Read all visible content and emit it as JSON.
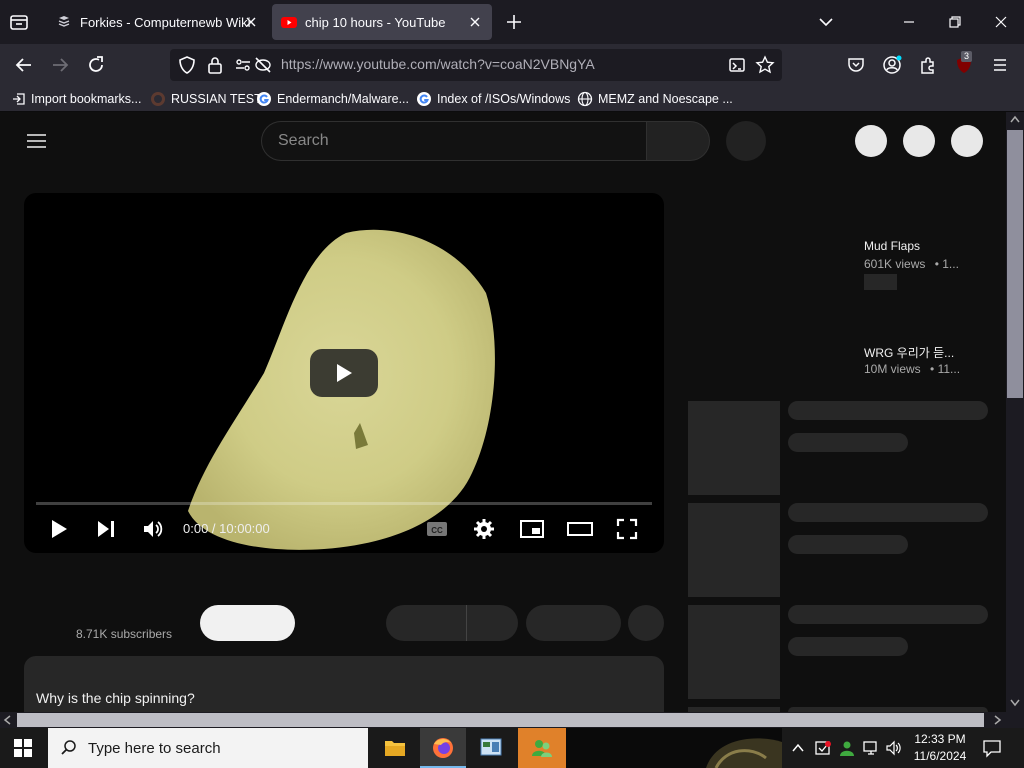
{
  "browser": {
    "tabs": [
      {
        "title": "Forkies - Computernewb Wiki",
        "active": false
      },
      {
        "title": "chip 10 hours - YouTube",
        "active": true
      }
    ],
    "url": "https://www.youtube.com/watch?v=coaN2VBNgYA",
    "extension_badge": "3",
    "bookmarks": [
      "Import bookmarks...",
      "RUSSIAN TEST",
      "Endermanch/Malware...",
      "Index of /ISOs/Windows",
      "MEMZ and Noescape ..."
    ]
  },
  "youtube": {
    "search_placeholder": "Search",
    "player": {
      "time": "0:00 / 10:00:00",
      "progress": 0.0
    },
    "subscribers": "8.71K subscribers",
    "description_text": "Why is the chip spinning?",
    "related": [
      {
        "title": "Mud Flaps",
        "views": "601K views",
        "age": "• 1..."
      },
      {
        "title": "WRG 우리가 듣...",
        "views": "10M views",
        "age": "• 11..."
      }
    ]
  },
  "taskbar": {
    "search_placeholder": "Type here to search",
    "time": "12:33 PM",
    "date": "11/6/2024"
  },
  "colors": {
    "youtube_red": "#ff0000",
    "yt_background": "#0f0f0f",
    "skeleton": "#272727",
    "firefox_tabbar": "#1c1b22",
    "firefox_toolbar": "#2b2a33"
  }
}
